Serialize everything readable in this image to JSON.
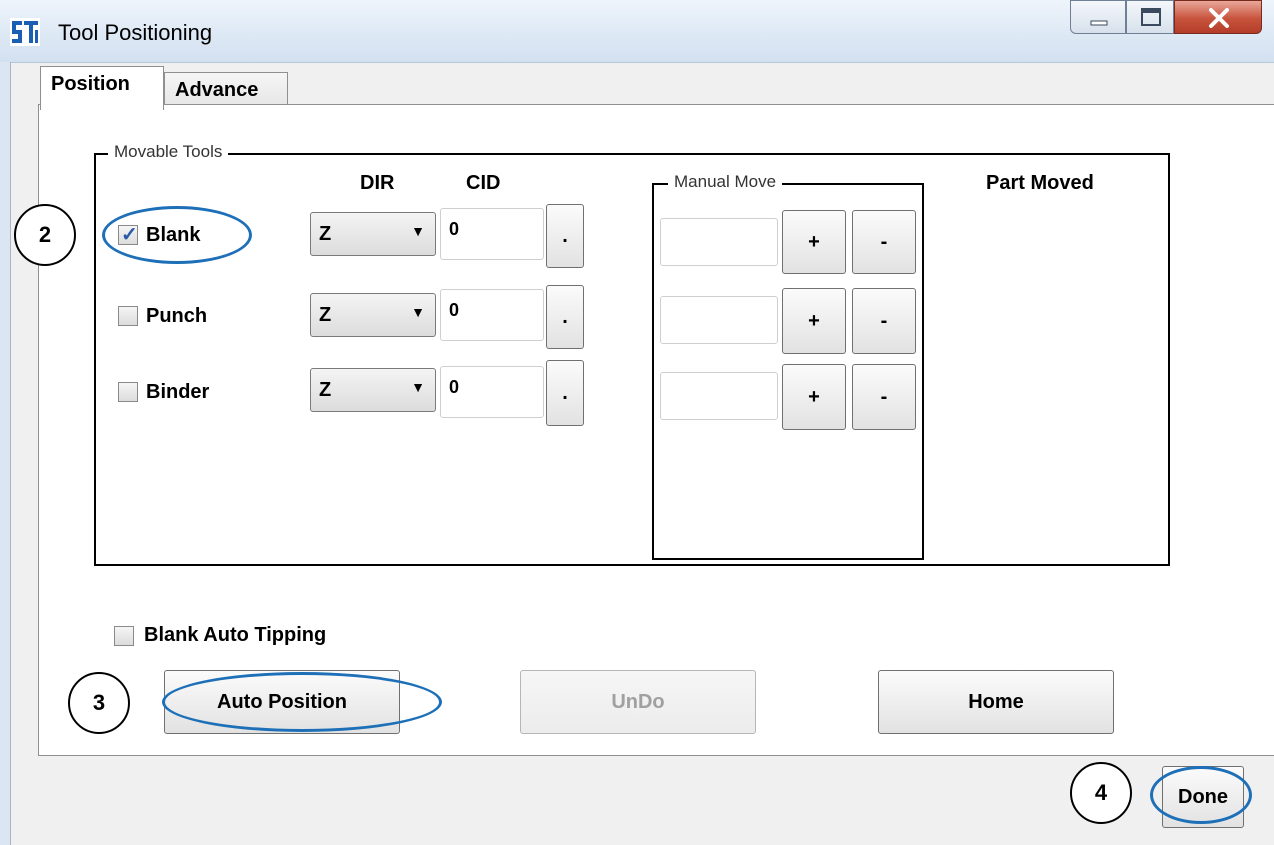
{
  "window": {
    "title": "Tool Positioning",
    "icon": "app-logo-icon",
    "controls": [
      "minimize-icon",
      "maximize-icon",
      "close-icon"
    ]
  },
  "tabs": [
    {
      "label": "Position",
      "active": true
    },
    {
      "label": "Advance",
      "active": false
    }
  ],
  "movable_tools": {
    "legend": "Movable Tools",
    "dir_header": "DIR",
    "cid_header": "CID",
    "rows": [
      {
        "label": "Blank",
        "checked": true,
        "dir": "Z",
        "cid": "0",
        "browse": "."
      },
      {
        "label": "Punch",
        "checked": false,
        "dir": "Z",
        "cid": "0",
        "browse": "."
      },
      {
        "label": "Binder",
        "checked": false,
        "dir": "Z",
        "cid": "0",
        "browse": "."
      }
    ]
  },
  "manual_move": {
    "legend": "Manual Move",
    "rows": [
      {
        "value": "",
        "plus": "+",
        "minus": "-"
      },
      {
        "value": "",
        "plus": "+",
        "minus": "-"
      },
      {
        "value": "",
        "plus": "+",
        "minus": "-"
      }
    ]
  },
  "part_moved": {
    "label": "Part Moved"
  },
  "blank_auto_tipping": {
    "label": "Blank Auto Tipping",
    "checked": false
  },
  "actions": {
    "auto_position": "Auto Position",
    "undo": "UnDo",
    "undo_enabled": false,
    "home": "Home",
    "done": "Done"
  },
  "callouts": {
    "step2": "2",
    "step3": "3",
    "step4": "4"
  },
  "colors": {
    "callout_ellipse": "#1d6fb8",
    "checkmark": "#2a5aa8",
    "close_button": "#c8543e"
  }
}
